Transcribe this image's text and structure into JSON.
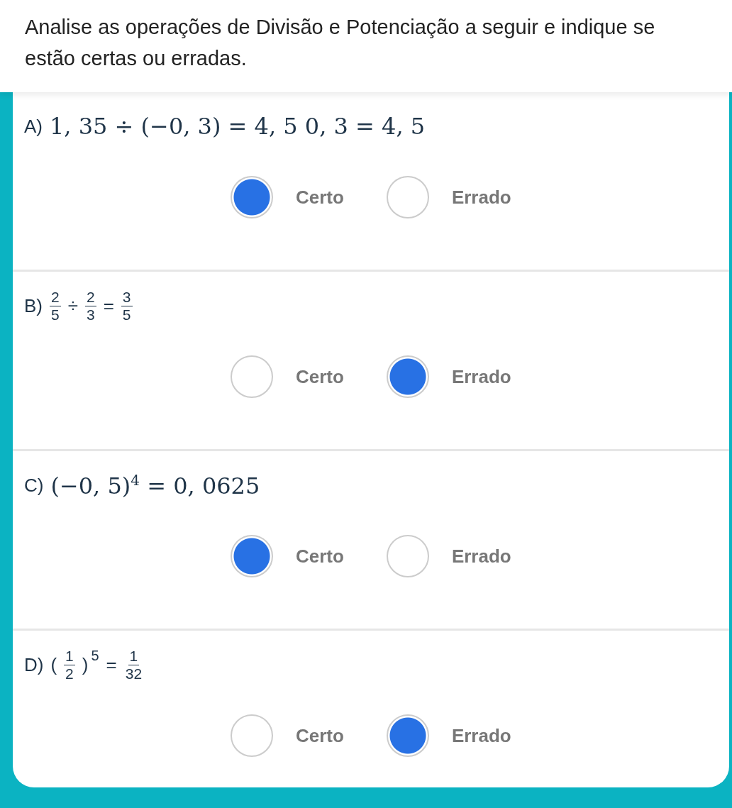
{
  "prompt": "Analise as operações de Divisão e Potenciação a seguir e indique se estão certas ou erradas.",
  "questions": [
    {
      "label": "A)",
      "expression": [
        {
          "kind": "math",
          "text": "1, 35 ÷ (−0, 3) = 4, 5 0, 3 = 4, 5"
        }
      ],
      "options": [
        {
          "label": "Certo",
          "selected": true
        },
        {
          "label": "Errado",
          "selected": false
        }
      ]
    },
    {
      "label": "B)",
      "expression": [
        {
          "kind": "frac",
          "num": "2",
          "den": "5"
        },
        {
          "kind": "op",
          "text": "÷"
        },
        {
          "kind": "frac",
          "num": "2",
          "den": "3"
        },
        {
          "kind": "op",
          "text": "="
        },
        {
          "kind": "frac",
          "num": "3",
          "den": "5"
        }
      ],
      "options": [
        {
          "label": "Certo",
          "selected": false
        },
        {
          "label": "Errado",
          "selected": true
        }
      ]
    },
    {
      "label": "C)",
      "expression": [
        {
          "kind": "math",
          "text": "(−0, 5)$^{4}$ = 0, 0625"
        }
      ],
      "options": [
        {
          "label": "Certo",
          "selected": true
        },
        {
          "label": "Errado",
          "selected": false
        }
      ]
    },
    {
      "label": "D)",
      "expression": [
        {
          "kind": "op",
          "text": "("
        },
        {
          "kind": "frac",
          "num": "1",
          "den": "2"
        },
        {
          "kind": "op",
          "text": ")"
        },
        {
          "kind": "sup",
          "text": "5"
        },
        {
          "kind": "op",
          "text": "="
        },
        {
          "kind": "frac",
          "num": "1",
          "den": "32"
        }
      ],
      "options": [
        {
          "label": "Certo",
          "selected": false
        },
        {
          "label": "Errado",
          "selected": true
        }
      ]
    }
  ]
}
